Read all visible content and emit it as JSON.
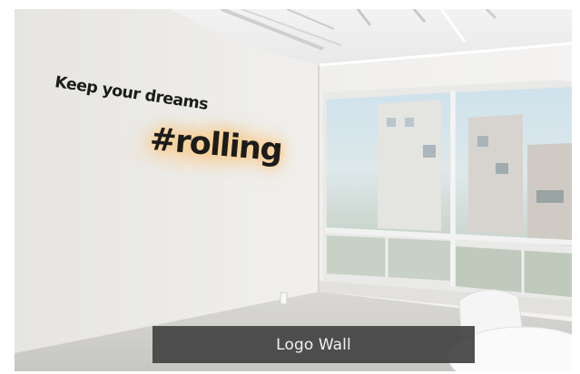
{
  "photo": {
    "tagline": "Keep your dreams",
    "brand": "#rolling"
  },
  "caption": {
    "label": "Logo Wall"
  },
  "colors": {
    "caption_bg": "#424242",
    "caption_text": "#f1f1f1",
    "wall": "#ecebe8",
    "lettering": "#1c1c1c",
    "backlight_glow": "#ffc478"
  }
}
